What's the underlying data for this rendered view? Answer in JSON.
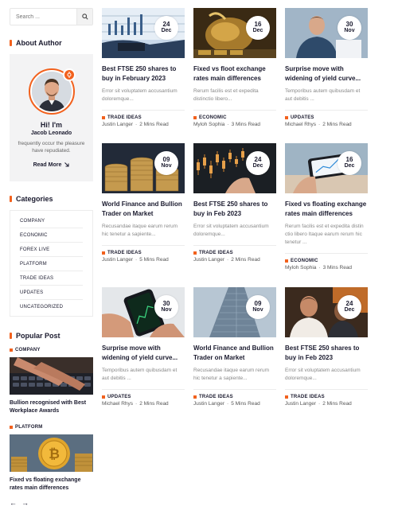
{
  "search": {
    "placeholder": "Search ..."
  },
  "about": {
    "heading": "About Author",
    "greeting": "Hi! I'm",
    "name": "Jacob Leonado",
    "description": "frequently occur the pleasure have repudiated.",
    "read_more": "Read More"
  },
  "categories": {
    "heading": "Categories",
    "items": [
      "Company",
      "Economic",
      "Forex Live",
      "Platform",
      "Trade Ideas",
      "Updates",
      "Uncategorized"
    ]
  },
  "popular": {
    "heading": "Popular Post",
    "posts": [
      {
        "tag": "COMPANY",
        "title": "Bullion recognised with Best Workplace Awards"
      },
      {
        "tag": "PLATFORM",
        "title": "Fixed vs floating exchange rates main differences"
      }
    ]
  },
  "pager": {
    "prev": "←",
    "next": "→"
  },
  "accent": "#f2611d",
  "posts": [
    {
      "day": "24",
      "month": "Dec",
      "title": "Best FTSE 250 shares to buy in February 2023",
      "excerpt": "Error sit voluptatem accusantium doloremque...",
      "tag": "TRADE IDEAS",
      "author": "Justin Langer",
      "sep": "·",
      "read": "2 Mins Read"
    },
    {
      "day": "16",
      "month": "Dec",
      "title": "Fixed vs floot exchange rates main differences",
      "excerpt": "Rerum facilis est et expedita distinctio libero...",
      "tag": "ECONOMIC",
      "author": "Myloh Sophia",
      "sep": "·",
      "read": "3 Mins Read"
    },
    {
      "day": "30",
      "month": "Nov",
      "title": "Surprise move with widening of yield curve...",
      "excerpt": "Temporibus autem quibusdam et aut debitis ...",
      "tag": "UPDATES",
      "author": "Michael Rhys",
      "sep": "·",
      "read": "2 Mins Read"
    },
    {
      "day": "09",
      "month": "Nov",
      "title": "World Finance and Bullion Trader on Market",
      "excerpt": "Recusandae itaque earum rerum hic tenetur a sapiente...",
      "tag": "TRADE IDEAS",
      "author": "Justin Langer",
      "sep": "·",
      "read": "5 Mins Read"
    },
    {
      "day": "24",
      "month": "Dec",
      "title": "Best FTSE 250 shares to buy in Feb 2023",
      "excerpt": "Error sit voluptatem accusantium doloremque...",
      "tag": "TRADE IDEAS",
      "author": "Justin Langer",
      "sep": "·",
      "read": "2 Mins Read"
    },
    {
      "day": "16",
      "month": "Dec",
      "title": "Fixed vs floating exchange rates main differences",
      "excerpt": "Rerum facilis est et expedita distin ctio libero Itaque earum rerum hic tenetur ...",
      "tag": "ECONOMIC",
      "author": "Myloh Sophia",
      "sep": "·",
      "read": "3 Mins Read"
    },
    {
      "day": "30",
      "month": "Nov",
      "title": "Surprise move with widening of yield curve...",
      "excerpt": "Temporibus autem quibusdam et aut debitis ...",
      "tag": "UPDATES",
      "author": "Michael Rhys",
      "sep": "·",
      "read": "2 Mins Read"
    },
    {
      "day": "09",
      "month": "Nov",
      "title": "World Finance and Bullion Trader on Market",
      "excerpt": "Recusandae itaque earum rerum hic tenetur a sapiente...",
      "tag": "TRADE IDEAS",
      "author": "Justin Langer",
      "sep": "·",
      "read": "5 Mins Read"
    },
    {
      "day": "24",
      "month": "Dec",
      "title": "Best FTSE 250 shares to buy in Feb 2023",
      "excerpt": "Error sit voluptatem accusantium doloremque...",
      "tag": "TRADE IDEAS",
      "author": "Justin Langer",
      "sep": "·",
      "read": "2 Mins Read"
    }
  ]
}
